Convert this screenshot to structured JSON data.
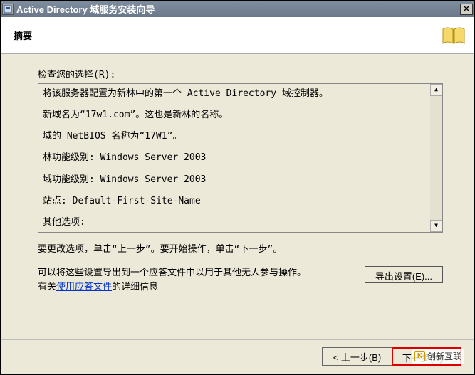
{
  "titlebar": {
    "title": "Active Directory 域服务安装向导"
  },
  "header": {
    "summary_label": "摘要"
  },
  "body": {
    "review_label": "检查您的选择(R):",
    "summary_lines": [
      "将该服务器配置为新林中的第一个 Active Directory 域控制器。",
      "新域名为“17w1.com”。这也是新林的名称。",
      "域的 NetBIOS 名称为“17W1”。",
      "林功能级别: Windows Server 2003",
      "域功能级别: Windows Server 2003",
      "站点: Default-First-Site-Name",
      "其他选项:"
    ],
    "instruction_text": "要更改选项，单击“上一步”。要开始操作，单击“下一步”。",
    "export_text_prefix": "可以将这些设置导出到一个应答文件中以用于其他无人参与操作。",
    "export_link_prefix": "有关",
    "export_link_text": "使用应答文件",
    "export_link_suffix": "的详细信息",
    "export_btn_label": "导出设置(E)..."
  },
  "footer": {
    "back_btn": "< 上一步(B)",
    "next_btn": "下一步(N) >"
  },
  "watermark": {
    "text": "创新互联"
  }
}
